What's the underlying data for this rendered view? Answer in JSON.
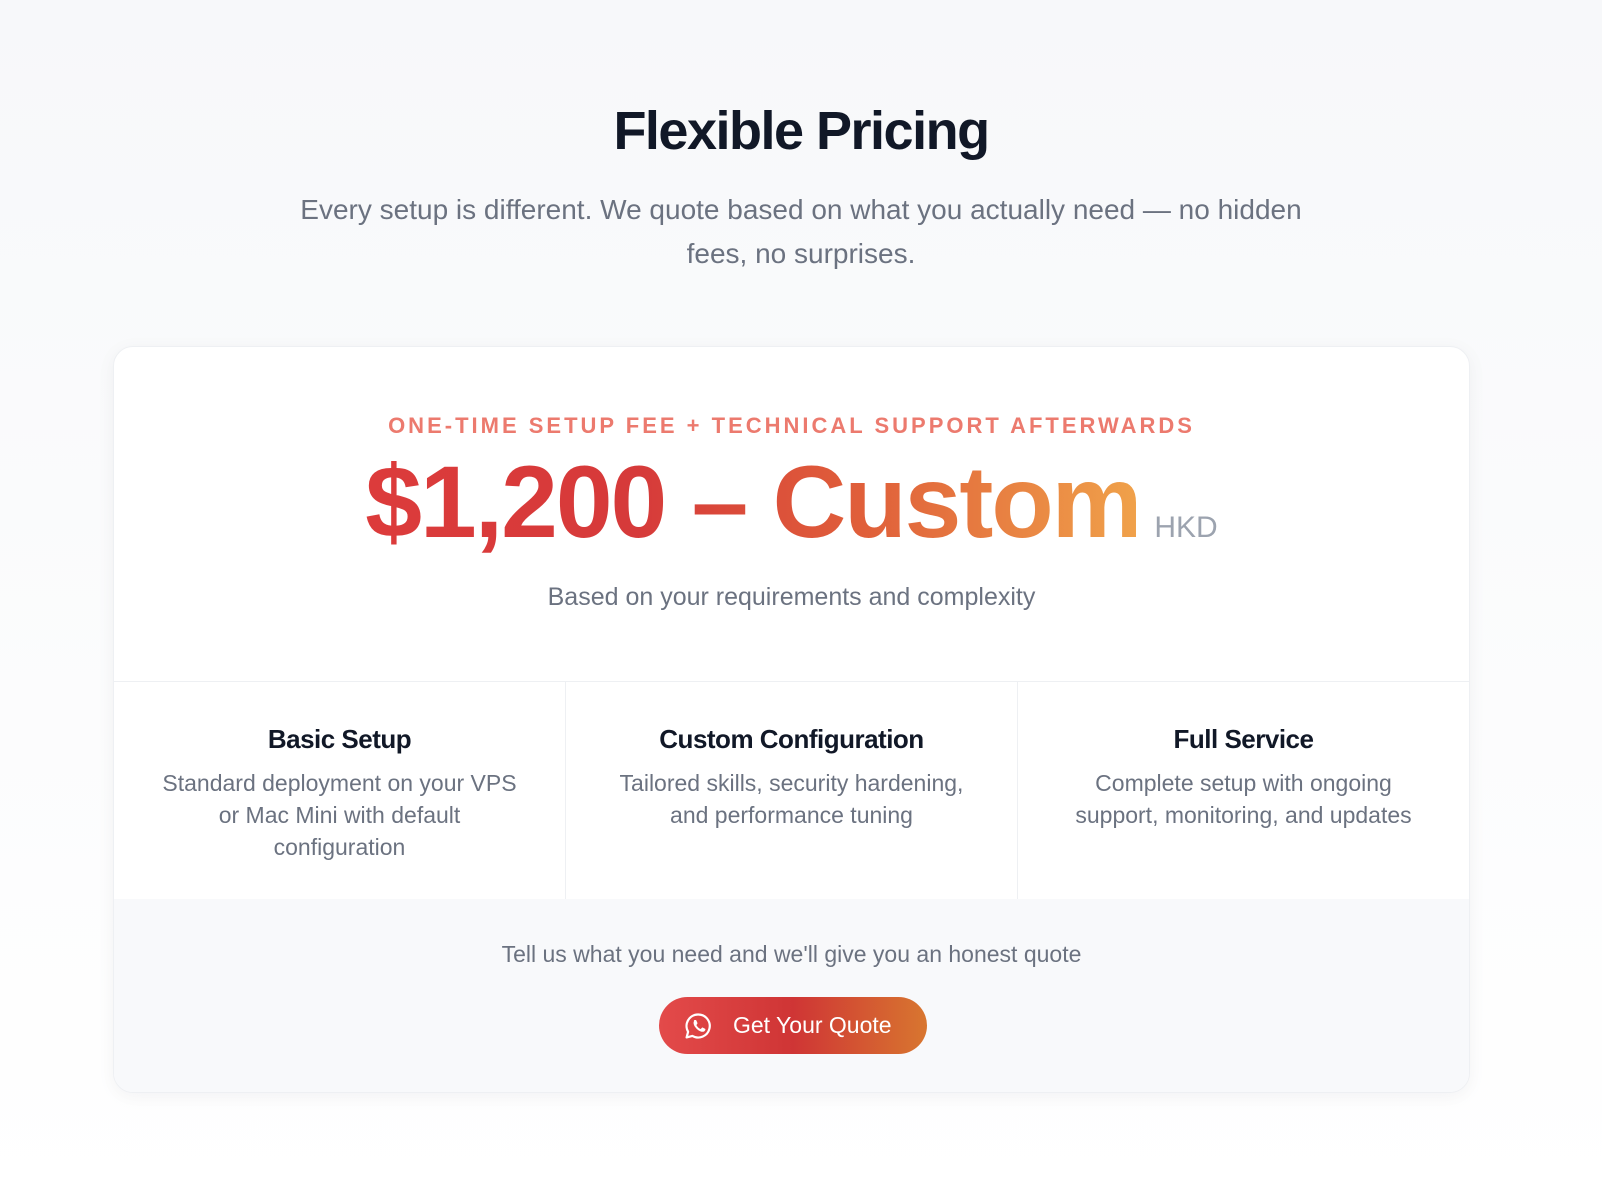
{
  "pricing": {
    "heading": "Flexible Pricing",
    "subtitle": "Every setup is different. We quote based on what you actually need — no hidden fees, no surprises.",
    "card": {
      "eyebrow": "ONE-TIME SETUP FEE + TECHNICAL SUPPORT AFTERWARDS",
      "price": "$1,200 – Custom",
      "currency": "HKD",
      "price_note": "Based on your requirements and complexity",
      "features": [
        {
          "title": "Basic Setup",
          "description": "Standard deployment on your VPS or Mac Mini with default configuration"
        },
        {
          "title": "Custom Configuration",
          "description": "Tailored skills, security hardening, and performance tuning"
        },
        {
          "title": "Full Service",
          "description": "Complete setup with ongoing support, monitoring, and updates"
        }
      ],
      "cta": {
        "text": "Tell us what you need and we'll give you an honest quote",
        "button_label": "Get Your Quote",
        "button_icon": "whatsapp-icon"
      }
    }
  },
  "colors": {
    "accent_red": "#dc3b3b",
    "accent_orange": "#f0a24a",
    "eyebrow": "#ec7a6e",
    "text_primary": "#111827",
    "text_muted": "#6b7280"
  }
}
